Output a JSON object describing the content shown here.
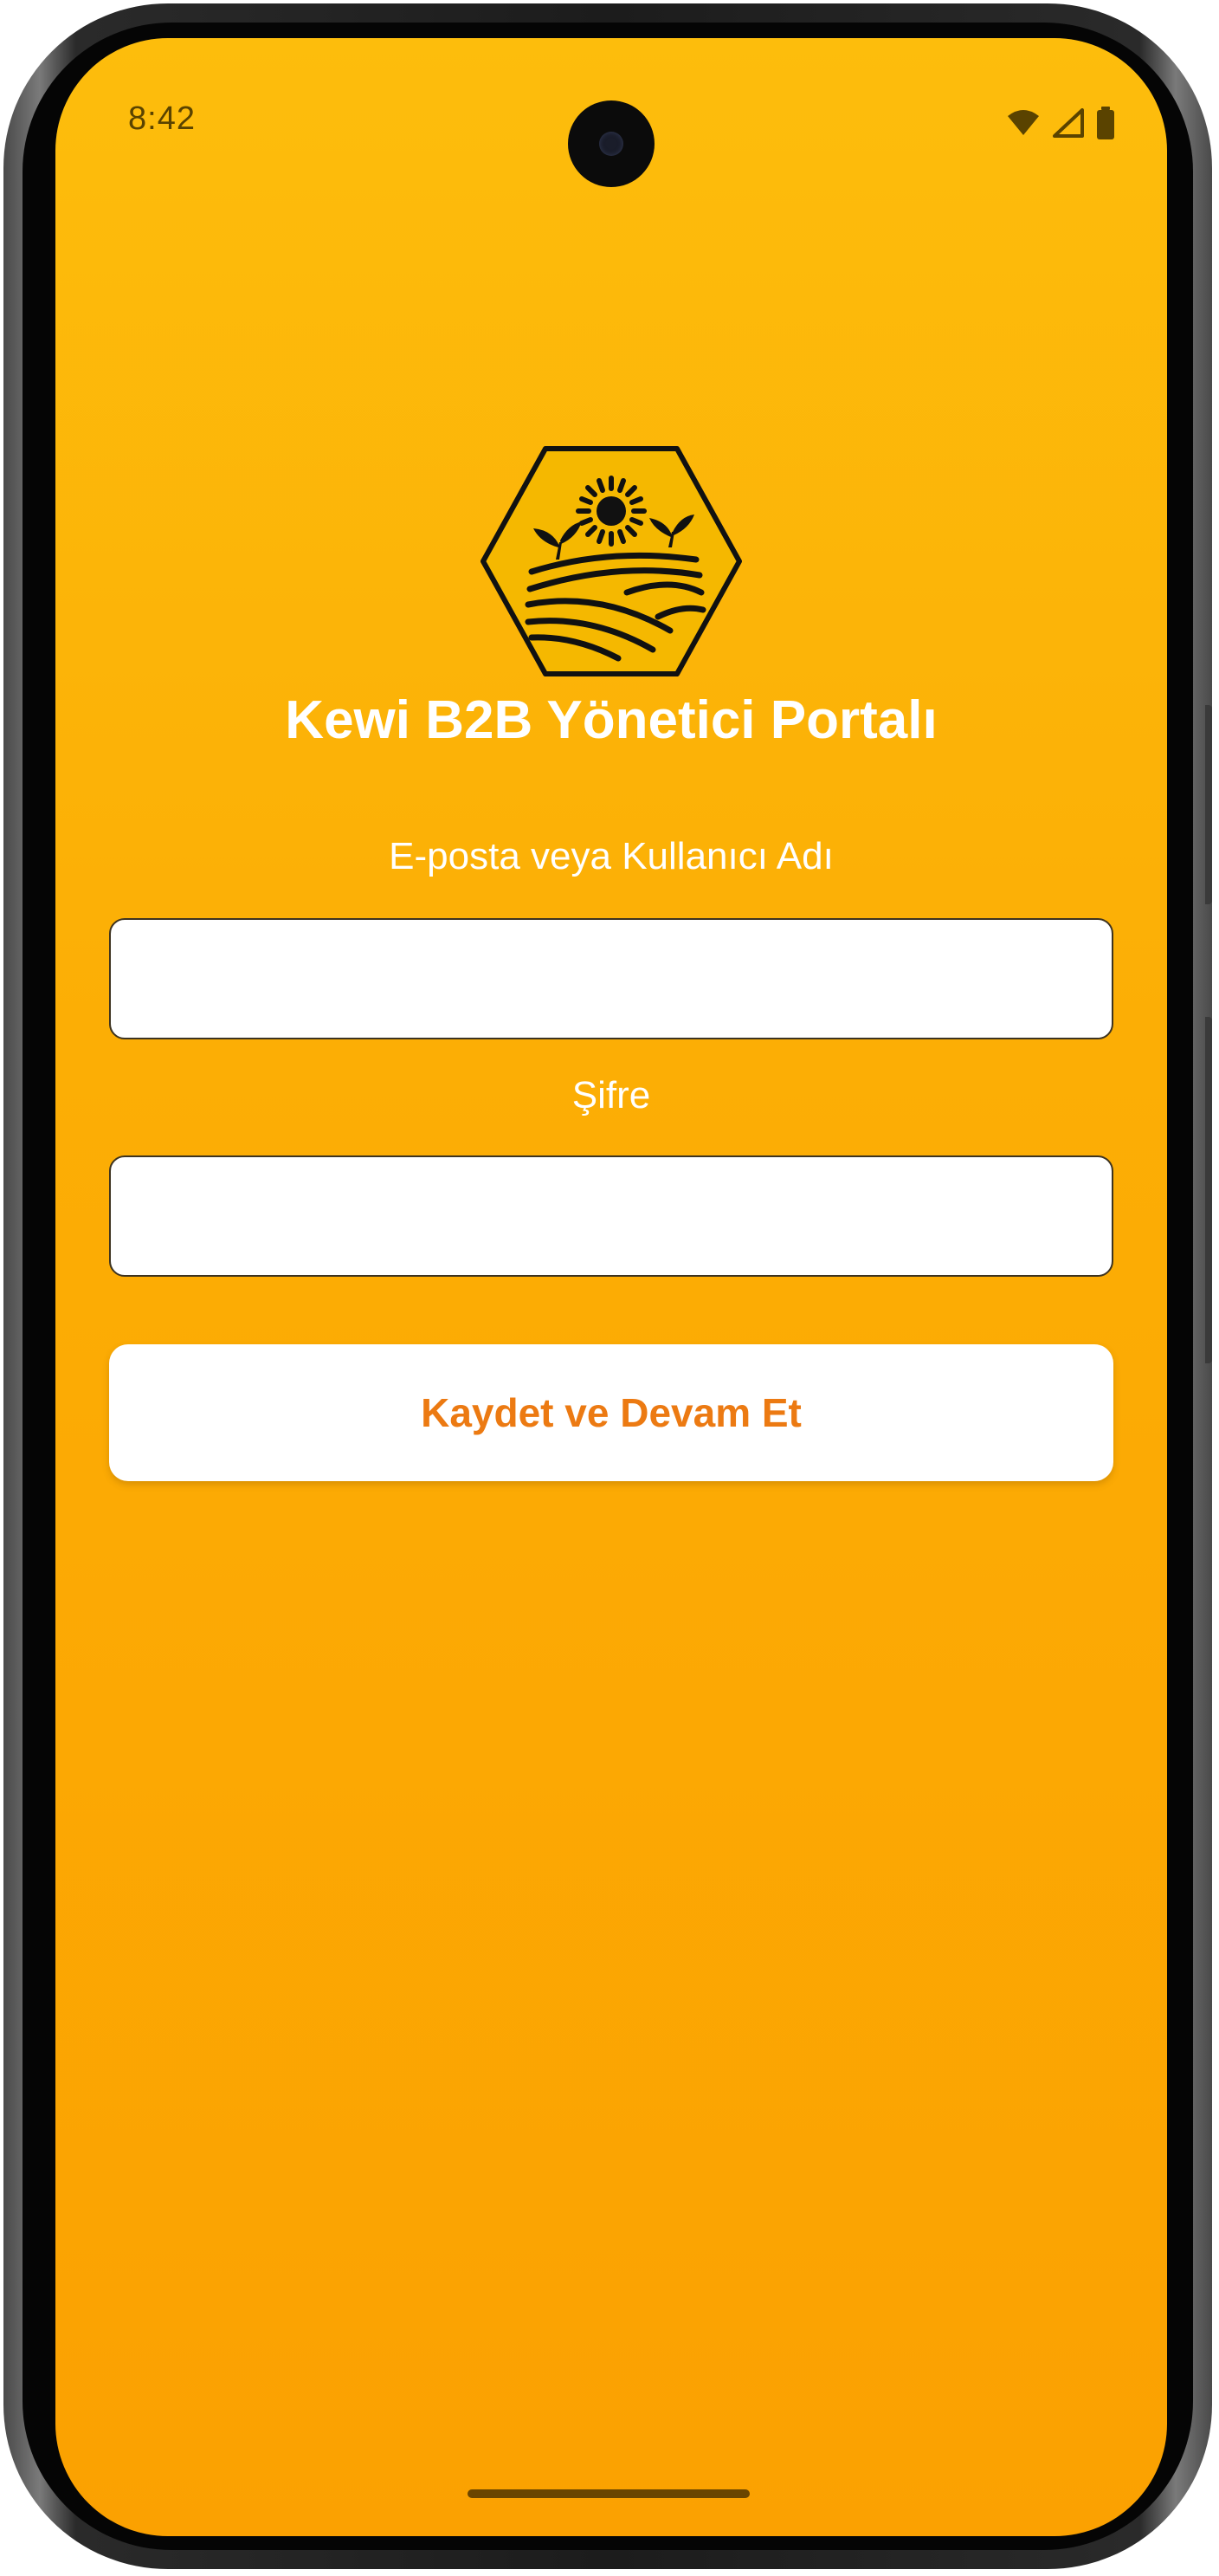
{
  "status_bar": {
    "time": "8:42",
    "icons": [
      "wifi-icon",
      "cellular-signal-icon",
      "battery-icon"
    ]
  },
  "app": {
    "logo": "hexagon-farm-sun-logo",
    "title": "Kewi B2B Yönetici Portalı"
  },
  "form": {
    "username_label": "E-posta veya Kullanıcı Adı",
    "username_value": "",
    "password_label": "Şifre",
    "password_value": "",
    "submit_label": "Kaydet ve Devam Et"
  },
  "colors": {
    "background_top": "#fdbd0c",
    "background_bottom": "#fba101",
    "button_text": "#ec7a12",
    "text": "#ffffff"
  }
}
